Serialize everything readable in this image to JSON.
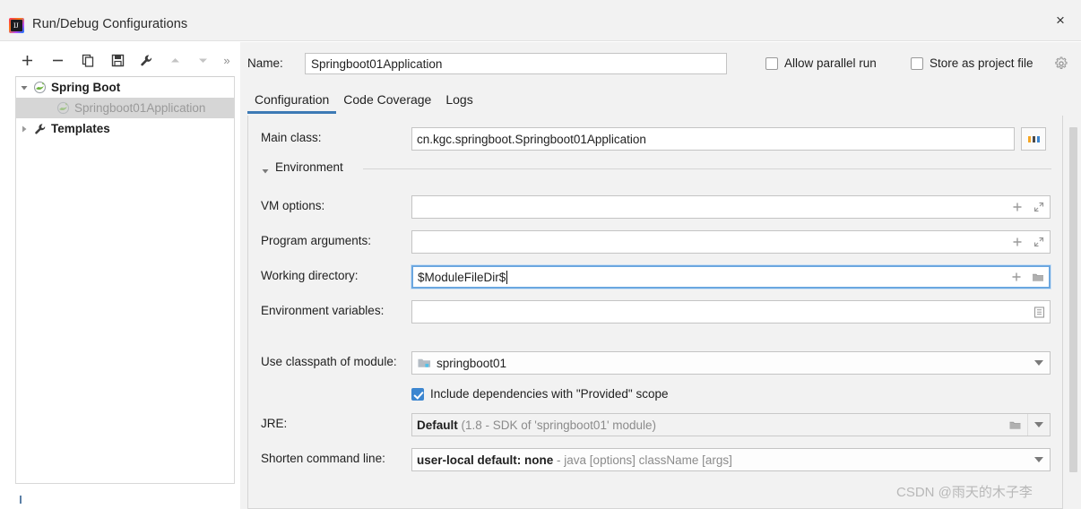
{
  "window": {
    "title": "Run/Debug Configurations",
    "app_icon": "intellij-idea-icon",
    "close_label": "×"
  },
  "toolbar": {
    "items": [
      {
        "name": "add-button",
        "glyph": "+",
        "enabled": true
      },
      {
        "name": "remove-button",
        "glyph": "−",
        "enabled": true
      },
      {
        "name": "copy-button",
        "glyph": "copy-icon",
        "enabled": true
      },
      {
        "name": "save-button",
        "glyph": "save-icon",
        "enabled": true
      },
      {
        "name": "edit-templates-button",
        "glyph": "wrench-icon",
        "enabled": true
      },
      {
        "name": "move-up-button",
        "glyph": "triangle-up-icon",
        "enabled": false
      },
      {
        "name": "move-down-button",
        "glyph": "triangle-down-icon",
        "enabled": false
      },
      {
        "name": "overflow-button",
        "glyph": "»",
        "enabled": true
      }
    ]
  },
  "tree": {
    "nodes": [
      {
        "label": "Spring Boot",
        "icon": "spring-boot-icon",
        "expanded": true,
        "selected": false,
        "indent": 0
      },
      {
        "label": "Springboot01Application",
        "icon": "spring-boot-icon",
        "expanded": null,
        "selected": true,
        "indent": 1
      },
      {
        "label": "Templates",
        "icon": "wrench-icon",
        "expanded": false,
        "selected": false,
        "indent": 0
      }
    ]
  },
  "header": {
    "name_label": "Name:",
    "name_value": "Springboot01Application",
    "allow_parallel_run": {
      "label": "Allow parallel run",
      "checked": false
    },
    "store_as_project_file": {
      "label": "Store as project file",
      "checked": false
    },
    "settings_icon": "gear-icon"
  },
  "tabs": [
    {
      "label": "Configuration",
      "active": true
    },
    {
      "label": "Code Coverage",
      "active": false
    },
    {
      "label": "Logs",
      "active": false
    }
  ],
  "form": {
    "main_class": {
      "label": "Main class:",
      "value": "cn.kgc.springboot.Springboot01Application",
      "browse_label": "...",
      "browse_icon": "ellipsis-browse-icon"
    },
    "environment_section": {
      "label": "Environment",
      "expanded": true,
      "collapse_icon": "triangle-down-icon"
    },
    "vm_options": {
      "label": "VM options:",
      "value": "",
      "icons": [
        "plus-icon",
        "expand-icon"
      ]
    },
    "program_arguments": {
      "label": "Program arguments:",
      "value": "",
      "icons": [
        "plus-icon",
        "expand-icon"
      ]
    },
    "working_directory": {
      "label": "Working directory:",
      "value": "$ModuleFileDir$",
      "focused": true,
      "icons": [
        "plus-icon",
        "folder-icon"
      ]
    },
    "environment_variables": {
      "label": "Environment variables:",
      "value": "",
      "icons": [
        "list-browse-icon"
      ]
    },
    "use_classpath_of_module": {
      "label": "Use classpath of module:",
      "value": "springboot01",
      "value_icon": "module-icon",
      "icons": [
        "chevron-down-icon"
      ]
    },
    "include_provided_scope": {
      "label": "Include dependencies with \"Provided\" scope",
      "checked": true
    },
    "jre": {
      "label": "JRE:",
      "value_strong": "Default",
      "value_dim": "(1.8 - SDK of 'springboot01' module)",
      "icons": [
        "folder-icon",
        "chevron-down-icon"
      ]
    },
    "shorten_command_line": {
      "label": "Shorten command line:",
      "value_strong": "user-local default: none",
      "value_dim": "- java [options] className [args]",
      "icons": [
        "chevron-down-icon"
      ]
    }
  },
  "scrollbar": {
    "name": "vertical-scrollbar",
    "thumb_top_pct": 2,
    "thumb_height_pct": 89
  },
  "watermark": {
    "text": "CSDN @雨天的木子李"
  },
  "colors": {
    "accent_blue": "#3d7ab5",
    "focus_blue": "#6ba7e0",
    "checkbox_blue": "#3c86d0",
    "panel_bg": "#f2f2f2",
    "field_bg": "#ffffff",
    "text": "#1f1f1f",
    "dim_text": "#8b8b8b",
    "selection_bg": "#d6d6d6"
  }
}
